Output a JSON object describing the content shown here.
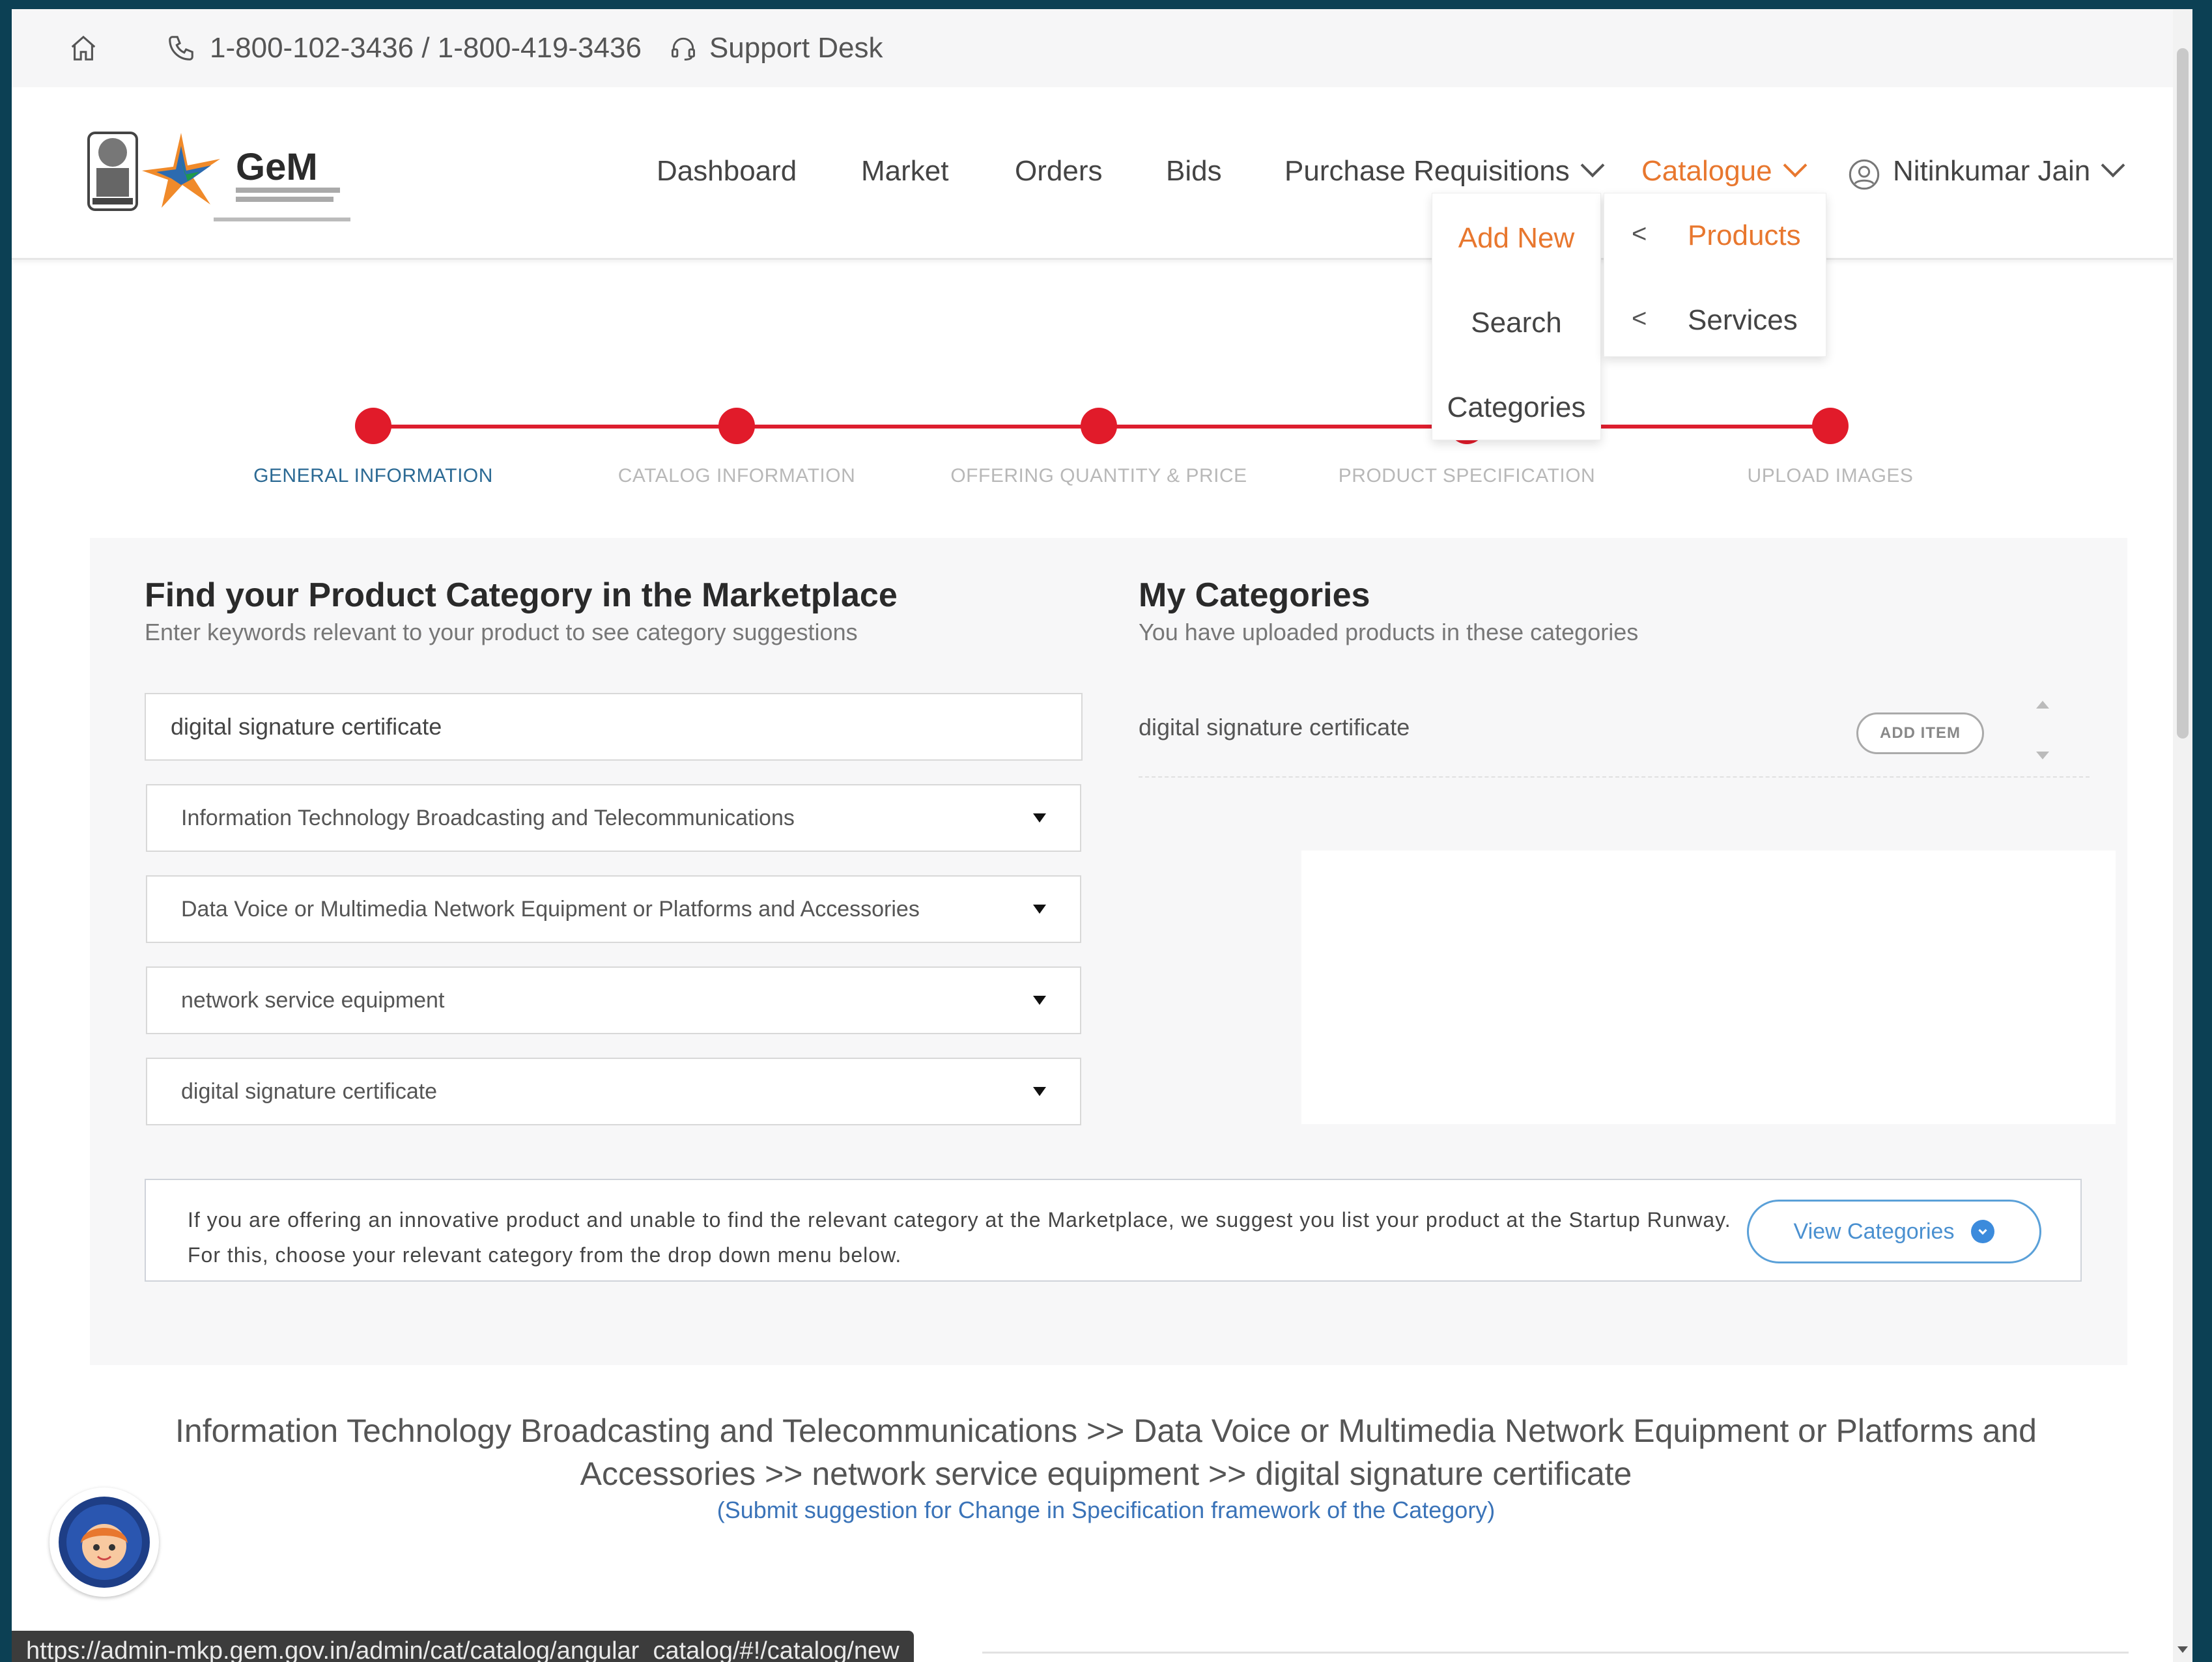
{
  "topbar": {
    "phone": "1-800-102-3436 / 1-800-419-3436",
    "support": "Support Desk",
    "home_icon": "home-icon",
    "phone_icon": "phone-icon",
    "support_icon": "headset-icon"
  },
  "logo": {
    "text": "GeM"
  },
  "nav": {
    "dashboard": "Dashboard",
    "market": "Market",
    "orders": "Orders",
    "bids": "Bids",
    "purchase_requisitions": "Purchase Requisitions",
    "catalogue": "Catalogue",
    "user": "Nitinkumar Jain"
  },
  "catalogue_menu": {
    "add_new": "Add New",
    "search": "Search",
    "categories": "Categories"
  },
  "add_new_submenu": {
    "products": "Products",
    "services": "Services",
    "arrow": "<"
  },
  "stepper": {
    "steps": [
      "GENERAL INFORMATION",
      "CATALOG INFORMATION",
      "OFFERING QUANTITY & PRICE",
      "PRODUCT SPECIFICATION",
      "UPLOAD IMAGES"
    ]
  },
  "find_category": {
    "title": "Find your Product Category in the Marketplace",
    "subtitle": "Enter keywords relevant to your product to see category suggestions",
    "search_value": "digital signature certificate",
    "selects": [
      "Information Technology Broadcasting and Telecommunications",
      "Data Voice or Multimedia Network Equipment or Platforms and Accessories",
      "network service equipment",
      "digital signature certificate"
    ]
  },
  "my_categories": {
    "title": "My Categories",
    "subtitle": "You have uploaded products in these categories",
    "items": [
      {
        "name": "digital signature certificate",
        "button": "ADD ITEM"
      }
    ]
  },
  "info": {
    "text": "If you are offering an innovative product and unable to find the relevant category at the Marketplace, we suggest you list your product at the Startup Runway. For this, choose your relevant category from the drop down menu below.",
    "button": "View Categories"
  },
  "category_path": {
    "text": "Information Technology Broadcasting and Telecommunications >> Data Voice or Multimedia Network Equipment or Platforms and Accessories >> network service equipment >> digital signature certificate",
    "link": "(Submit suggestion for Change in Specification framework of the Category)"
  },
  "status_bar": {
    "url": "https://admin-mkp.gem.gov.in/admin/cat/catalog/angular_catalog/#!/catalog/new"
  },
  "colors": {
    "accent": "#e8772e",
    "step_red": "#dd1e2e",
    "link_blue": "#3a73b8",
    "frame": "#0c4054"
  }
}
